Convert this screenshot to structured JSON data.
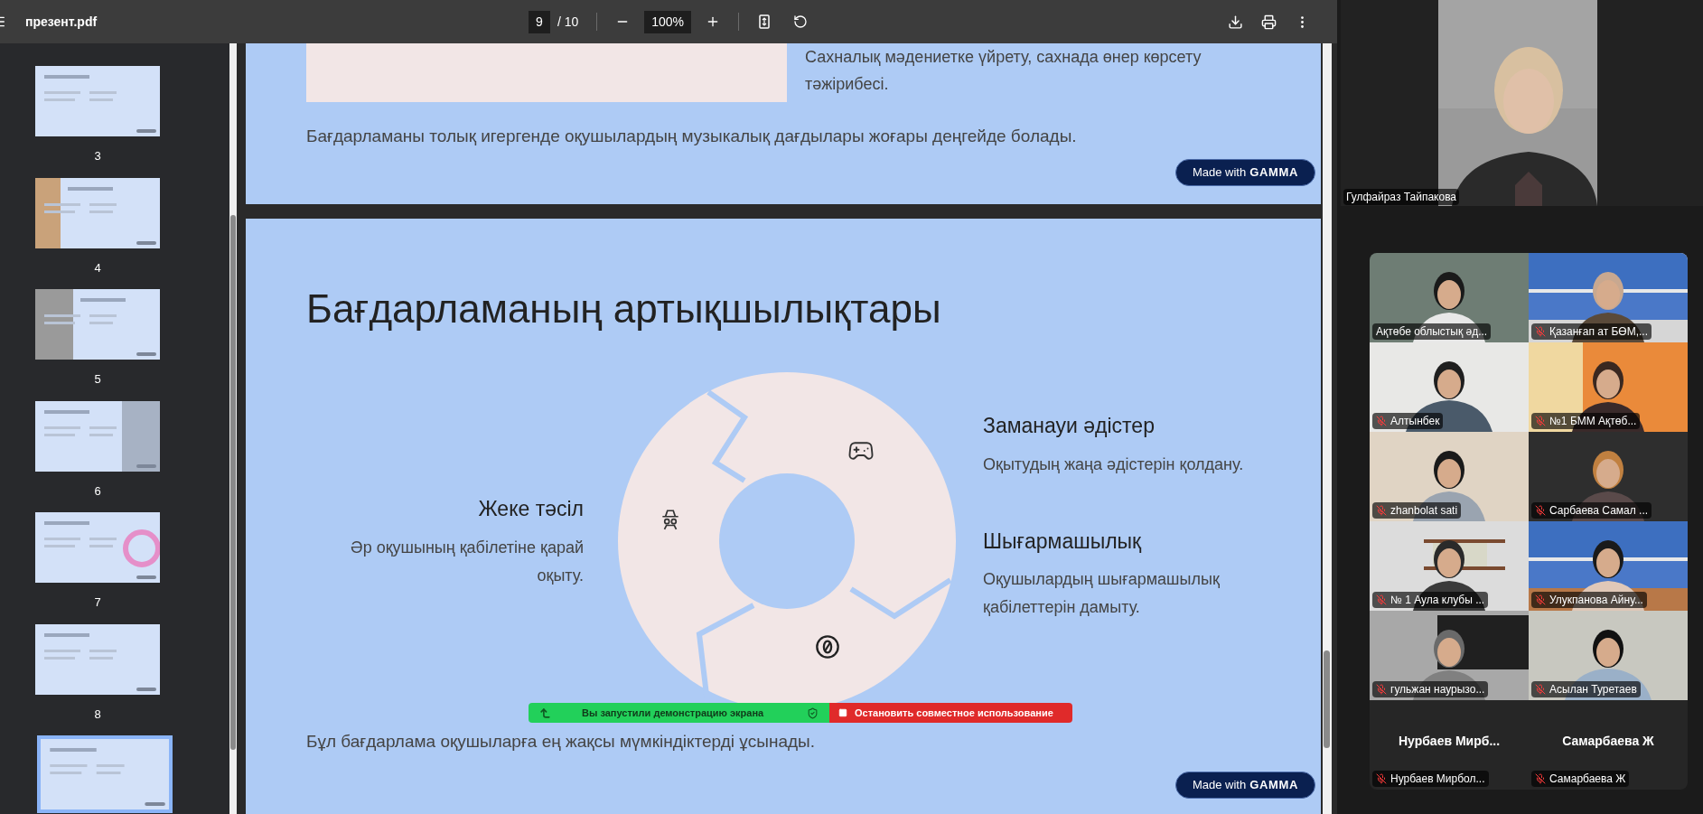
{
  "toolbar": {
    "filename": "презент.pdf",
    "page": "9",
    "page_total": "/ 10",
    "zoom": "100%"
  },
  "thumbnails": [
    {
      "label": "3",
      "selected": false
    },
    {
      "label": "4",
      "selected": false
    },
    {
      "label": "5",
      "selected": false
    },
    {
      "label": "6",
      "selected": false
    },
    {
      "label": "7",
      "selected": false
    },
    {
      "label": "8",
      "selected": false
    },
    {
      "selected": true
    }
  ],
  "slide_top": {
    "lines": [
      "Сахналық мәдениетке үйрету, сахнада өнер көрсету",
      "тәжірибесі."
    ],
    "summary": "Бағдарламаны толық игергенде оқушылардың музыкалық дағдылары жоғары деңгейде болады.",
    "badge": {
      "prefix": "Made with",
      "brand": "GAMMA"
    }
  },
  "slide_main": {
    "title": "Бағдарламаның артықшылықтары",
    "features": [
      {
        "kind": "left",
        "title": "Жеке тәсіл",
        "description": "Әр оқушының қабілетіне қарай оқыту."
      },
      {
        "kind": "right",
        "title": "Заманауи әдістер",
        "description": "Оқытудың жаңа әдістерін қолдану."
      },
      {
        "kind": "right",
        "title": "Шығармашылық",
        "description": "Оқушылардың шығармашылық қабілеттерін дамыту."
      }
    ],
    "summary": "Бұл бағдарлама оқушыларға ең жақсы мүмкіндіктерді ұсынады.",
    "badge": {
      "prefix": "Made with",
      "brand": "GAMMA"
    }
  },
  "share_bar": {
    "status": "Вы запустили демонстрацию экрана",
    "stop": "Остановить совместное использование"
  },
  "speaker": {
    "name": "Гулфайраз Тайпакова"
  },
  "participants": [
    {
      "kind": "video",
      "name": "Ақтөбе облыстық әд...",
      "muted": false
    },
    {
      "kind": "video",
      "name": "Қазанғап ат БӨМ,...",
      "muted": true
    },
    {
      "kind": "video",
      "name": "Алтынбек",
      "muted": true
    },
    {
      "kind": "video",
      "name": "№1 БММ  Ақтөб...",
      "muted": true
    },
    {
      "kind": "video",
      "name": "zhanbolat sati",
      "muted": true
    },
    {
      "kind": "video",
      "name": "Сарбаева Самал ...",
      "muted": true
    },
    {
      "kind": "video",
      "name": "№ 1 Аула клубы ...",
      "muted": true
    },
    {
      "kind": "video",
      "name": "Улукпанова Айну...",
      "muted": true
    },
    {
      "kind": "video",
      "name": "гульжан наурызо...",
      "muted": true
    },
    {
      "kind": "video",
      "name": "Асылан Туретаев",
      "muted": true
    },
    {
      "kind": "avatar",
      "display_name": "Нурбаев  Мирб...",
      "name": "Нурбаев Мирбол...",
      "muted": true
    },
    {
      "kind": "avatar",
      "display_name": "Самарбаева Ж",
      "name": "Самарбаева Ж",
      "muted": true
    }
  ]
}
